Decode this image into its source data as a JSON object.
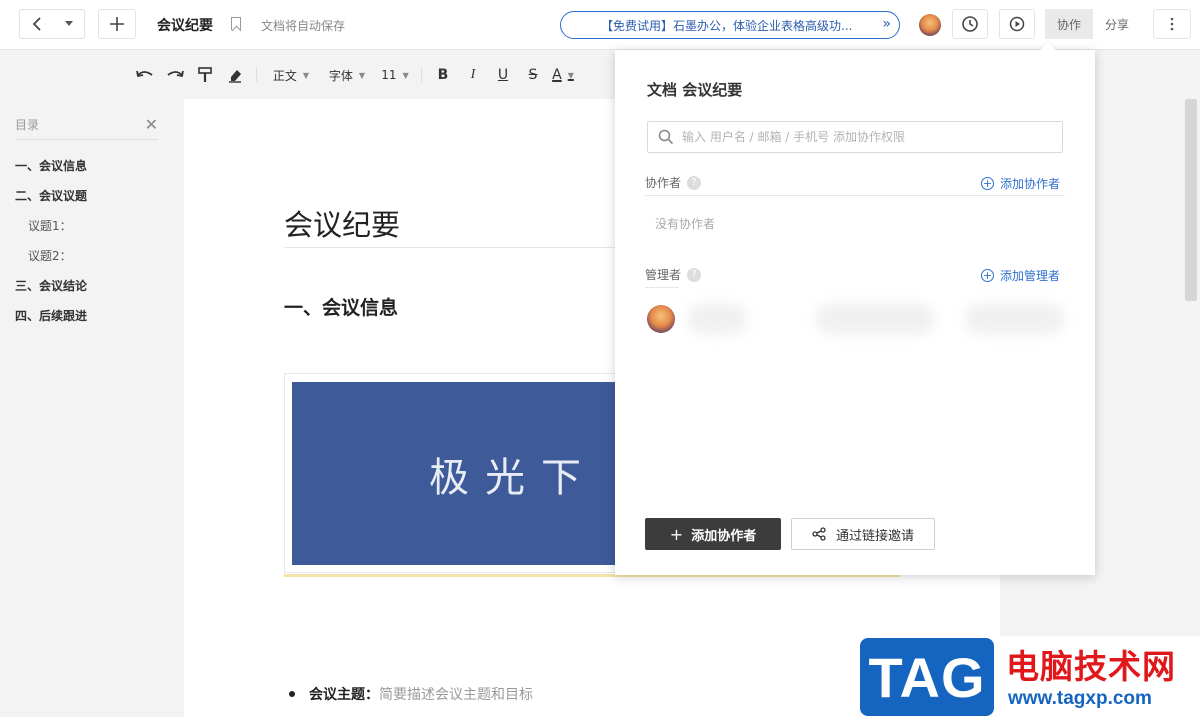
{
  "header": {
    "title": "会议纪要",
    "autosave": "文档将自动保存",
    "promo": "【免费试用】石墨办公，体验企业表格高级功...",
    "tab_collab": "协作",
    "tab_share": "分享"
  },
  "toolbar": {
    "style": "正文",
    "font": "字体",
    "size": "11",
    "bold": "B",
    "italic": "I",
    "underline": "U",
    "strike": "S",
    "color": "A"
  },
  "outline": {
    "title": "目录",
    "items": [
      {
        "label": "一、会议信息",
        "level": 1
      },
      {
        "label": "二、会议议题",
        "level": 1
      },
      {
        "label": "议题1：",
        "level": 2
      },
      {
        "label": "议题2：",
        "level": 2
      },
      {
        "label": "三、会议结论",
        "level": 1
      },
      {
        "label": "四、后续跟进",
        "level": 1
      }
    ]
  },
  "document": {
    "heading": "会议纪要",
    "section1": "一、会议信息",
    "banner_text": "极光下",
    "bullet_label": "会议主题：",
    "bullet_desc": "简要描述会议主题和目标"
  },
  "share_panel": {
    "title": "文档 会议纪要",
    "search_placeholder": "输入 用户名 / 邮箱 / 手机号 添加协作权限",
    "collaborators_label": "协作者",
    "add_collaborator_link": "添加协作者",
    "no_collaborators": "没有协作者",
    "managers_label": "管理者",
    "add_manager_link": "添加管理者",
    "btn_add_collaborator": "添加协作者",
    "btn_invite_link": "通过链接邀请"
  },
  "watermark": {
    "tag": "TAG",
    "site_name": "电脑技术网",
    "url": "www.tagxp.com"
  },
  "colors": {
    "accent": "#2f6fd0",
    "banner": "#3e5a99",
    "primary_button": "#3c3c3c"
  }
}
